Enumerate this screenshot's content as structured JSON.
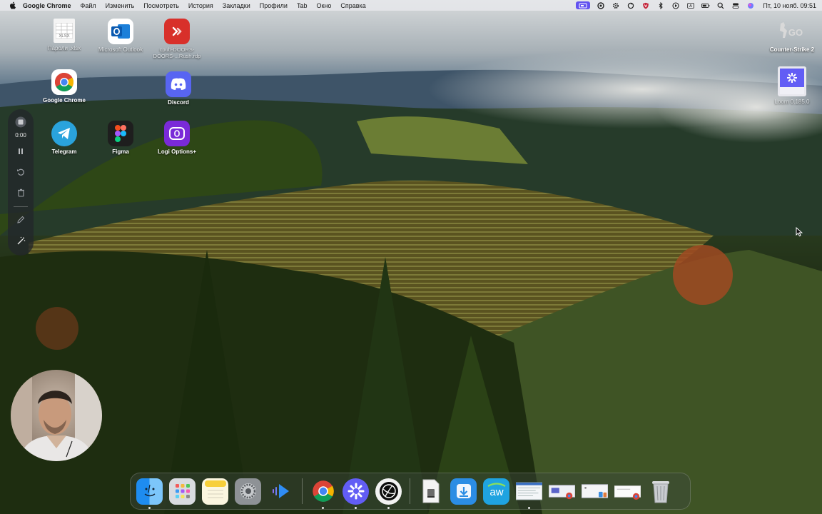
{
  "menubar": {
    "app_name": "Google Chrome",
    "menus": [
      "Файл",
      "Изменить",
      "Посмотреть",
      "История",
      "Закладки",
      "Профили",
      "Tab",
      "Окно",
      "Справка"
    ],
    "datetime": "Пт, 10 нояб.  09:51"
  },
  "desktop": {
    "icons": [
      {
        "label": "Пароли .xlsx",
        "icon": "spreadsheet-file-icon"
      },
      {
        "label": "Microsoft Outlook",
        "icon": "outlook-icon"
      },
      {
        "label": "cpub-DOORS-DOORS-...Rush.rdp",
        "icon": "remote-desktop-icon"
      },
      {
        "label": "Google Chrome",
        "icon": "chrome-icon"
      },
      {
        "label": "Discord",
        "icon": "discord-icon"
      },
      {
        "label": "Telegram",
        "icon": "telegram-icon"
      },
      {
        "label": "Figma",
        "icon": "figma-icon"
      },
      {
        "label": "Logi Options+",
        "icon": "logi-options-icon"
      },
      {
        "label": "Counter-Strike 2",
        "icon": "counter-strike-icon"
      },
      {
        "label": "Loom 0.185.0",
        "icon": "loom-installer-icon"
      }
    ]
  },
  "recorder": {
    "time": "0:00"
  },
  "dock": {
    "apps": [
      "Finder",
      "Launchpad",
      "Notes",
      "System Settings",
      "Loom Voice",
      "Google Chrome",
      "Loom",
      "Perplexity",
      "Disk image",
      "Downloads",
      "ActivityWatch",
      "Window preview 1",
      "Window preview 2",
      "Window preview 3",
      "Window preview 4",
      "Trash"
    ]
  },
  "colors": {
    "menubar_bg": "#e6e8ec",
    "loom_accent": "#6252f0",
    "recorder_bg": "#23262a"
  }
}
